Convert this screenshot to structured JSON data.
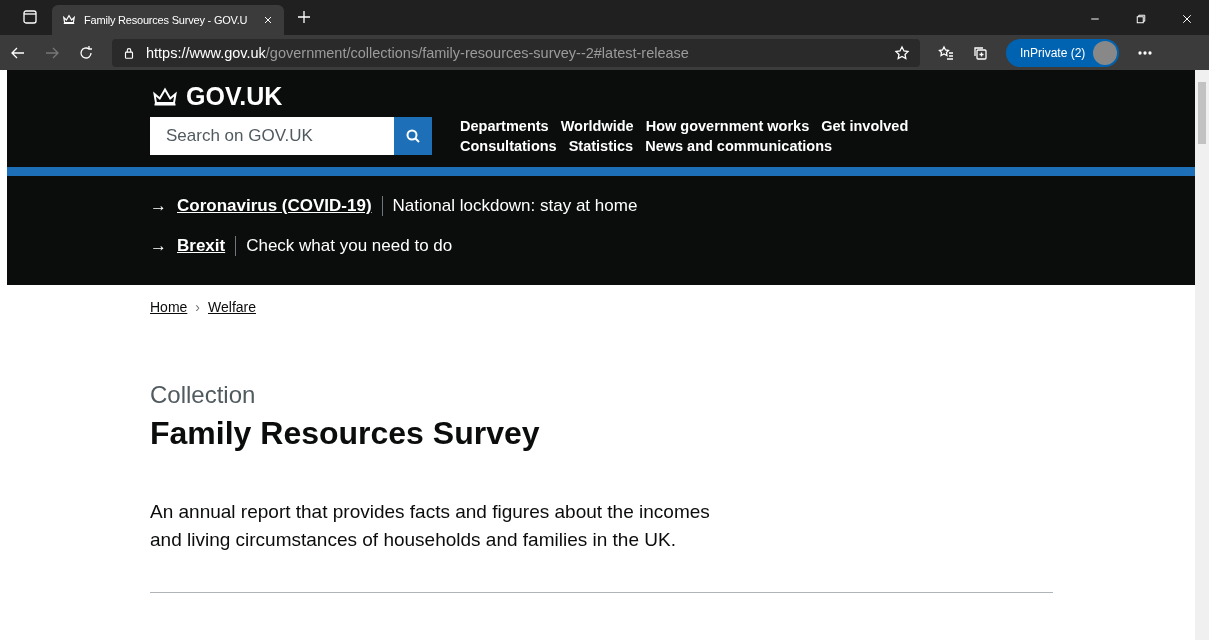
{
  "browser": {
    "tab": {
      "title": "Family Resources Survey - GOV.U",
      "selected": true
    },
    "url": {
      "scheme": "https://",
      "host": "www.gov.uk",
      "path": "/government/collections/family-resources-survey--2#latest-release"
    },
    "inprivate": "InPrivate (2)"
  },
  "header": {
    "logo": "GOV.UK",
    "search": {
      "placeholder": "Search on GOV.UK"
    },
    "nav": [
      [
        "Departments",
        "Worldwide",
        "How government works",
        "Get involved"
      ],
      [
        "Consultations",
        "Statistics",
        "News and communications"
      ]
    ]
  },
  "banner": [
    {
      "arrow": "→",
      "link": "Coronavirus (COVID-19)",
      "text": "National lockdown: stay at home"
    },
    {
      "arrow": "→",
      "link": "Brexit",
      "text": "Check what you need to do"
    }
  ],
  "breadcrumbs": {
    "items": [
      "Home",
      "Welfare"
    ],
    "separator": "›"
  },
  "caption": "Collection",
  "title": "Family Resources Survey",
  "lead": "An annual report that provides facts and figures about the incomes and living circumstances of households and families in the UK."
}
